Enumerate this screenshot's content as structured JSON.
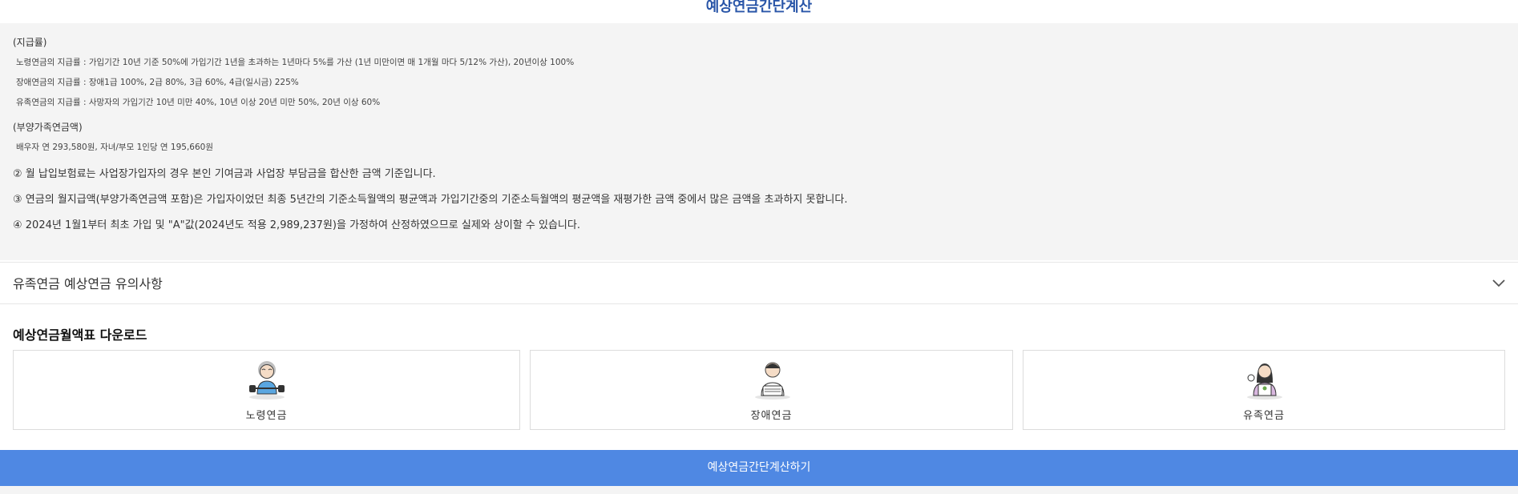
{
  "header": {
    "title": "예상연금간단계산"
  },
  "info": {
    "payment_rate_heading": "(지급률)",
    "old_age_rate": "노령연금의 지급률 : 가입기간 10년 기준 50%에 가입기간 1년을 초과하는 1년마다 5%를 가산 (1년 미만이면 매 1개월 마다 5/12% 가산), 20년이상 100%",
    "disability_rate": "장애연금의 지급률 : 장애1급 100%, 2급 80%, 3급 60%, 4급(일시금) 225%",
    "survivor_rate": "유족연금의 지급률 : 사망자의 가입기간 10년 미만 40%, 10년 이상 20년 미만 50%, 20년 이상 60%",
    "dependent_heading": "(부양가족연금액)",
    "dependent_amount": "배우자 연 293,580원, 자녀/부모 1인당 연 195,660원",
    "note2": "② 월 납입보험료는 사업장가입자의 경우 본인 기여금과 사업장 부담금을 합산한 금액 기준입니다.",
    "note3": "③ 연금의 월지급액(부양가족연금액 포함)은 가입자이었던 최종 5년간의 기준소득월액의 평균액과 가입기간중의 기준소득월액의 평균액을 재평가한 금액 중에서 많은 금액을 초과하지 못합니다.",
    "note4": "④ 2024년 1월1부터 최초 가입 및 \"A\"값(2024년도 적용 2,989,237원)을 가정하여 산정하였으므로 실제와 상이할 수 있습니다."
  },
  "accordion": {
    "label": "유족연금 예상연금 유의사항",
    "icon": "chevron-down-icon"
  },
  "download": {
    "title": "예상연금월액표 다운로드",
    "cards": [
      {
        "label": "노령연금",
        "icon": "elderly-person-icon"
      },
      {
        "label": "장애연금",
        "icon": "disabled-person-icon"
      },
      {
        "label": "유족연금",
        "icon": "survivor-family-icon"
      }
    ]
  },
  "action": {
    "calc_button": "예상연금간단계산하기"
  },
  "colors": {
    "accent": "#4f88e3",
    "title": "#2a56a8",
    "panel": "#f4f4f4"
  }
}
